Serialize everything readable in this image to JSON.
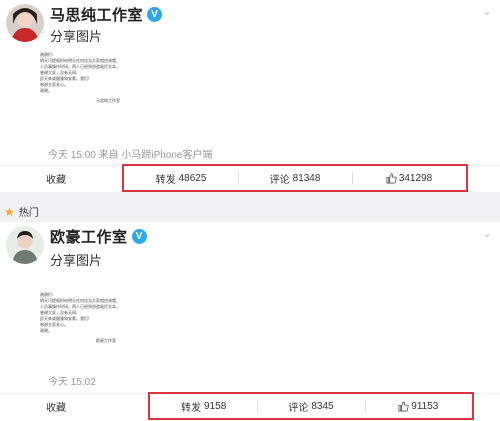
{
  "colors": {
    "accent": "#d9363e",
    "verified": "#2fa8e8",
    "star": "#f5a623"
  },
  "posts": [
    {
      "username": "马思纯工作室",
      "verified_icon": "verified-badge-icon",
      "text": "分享图片",
      "letter": {
        "greeting": "谢谢们:",
        "lines": [
          "明天可提倡时给明天任何适当大家相应成就,",
          "人员事情作时间，两人已经到创造极坏文本。"
        ],
        "lines2": [
          "感谢大家，没有天网。",
          "愿天来或健康和安素，我们!"
        ],
        "closing": [
          "感谢大家关心。",
          "谢谢。"
        ],
        "signature": "马思纯工作室"
      },
      "meta": "今天 15:00 来自 小马蹄iPhone客户端",
      "favorite": "收藏",
      "repost_label": "转发",
      "repost_count": "48625",
      "comment_label": "评论",
      "comment_count": "81348",
      "like_count": "341298"
    },
    {
      "username": "欧豪工作室",
      "verified_icon": "verified-badge-icon",
      "text": "分享图片",
      "letter": {
        "greeting": "谢谢们:",
        "lines": [
          "明天可提倡时给明天任何适当大家相应成就,",
          "人员事情作时间，两人已经到创造极坏文本。"
        ],
        "lines2": [
          "感谢大家，没有天网。",
          "愿天来或健康和安素，我们!"
        ],
        "closing": [
          "感谢大家关心。",
          "谢谢。"
        ],
        "signature": "欧豪工作室"
      },
      "meta": "今天 15:02",
      "favorite": "收藏",
      "repost_label": "转发",
      "repost_count": "9158",
      "comment_label": "评论",
      "comment_count": "8345",
      "like_count": "91153"
    }
  ],
  "hot_label": "热门"
}
